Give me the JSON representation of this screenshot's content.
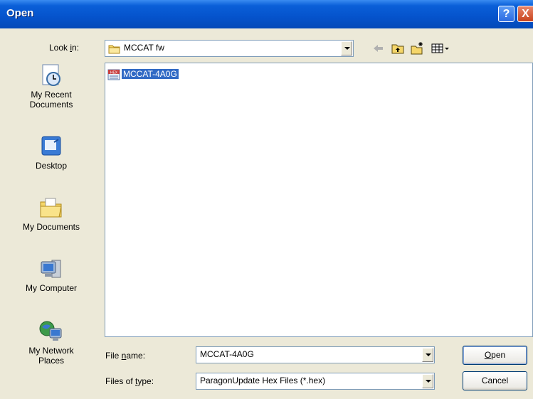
{
  "window": {
    "title": "Open",
    "help": "?",
    "close": "X"
  },
  "lookin": {
    "label": "Look in:",
    "folder": "MCCAT fw"
  },
  "toolbar": {
    "back": "back-arrow-icon",
    "up": "up-folder-icon",
    "new": "new-folder-icon",
    "views": "views-menu-icon"
  },
  "places": [
    {
      "label1": "My Recent",
      "label2": "Documents",
      "icon": "recent-documents-icon"
    },
    {
      "label1": "Desktop",
      "label2": "",
      "icon": "desktop-icon"
    },
    {
      "label1": "My Documents",
      "label2": "",
      "icon": "my-documents-icon"
    },
    {
      "label1": "My Computer",
      "label2": "",
      "icon": "my-computer-icon"
    },
    {
      "label1": "My Network",
      "label2": "Places",
      "icon": "network-places-icon"
    }
  ],
  "files": [
    {
      "name": "MCCAT-4A0G",
      "icon": "hex-file-icon"
    }
  ],
  "filename": {
    "label": "File name:",
    "value": "MCCAT-4A0G"
  },
  "filetype": {
    "label": "Files of type:",
    "value": "ParagonUpdate Hex Files (*.hex)"
  },
  "buttons": {
    "open": "Open",
    "cancel": "Cancel"
  }
}
